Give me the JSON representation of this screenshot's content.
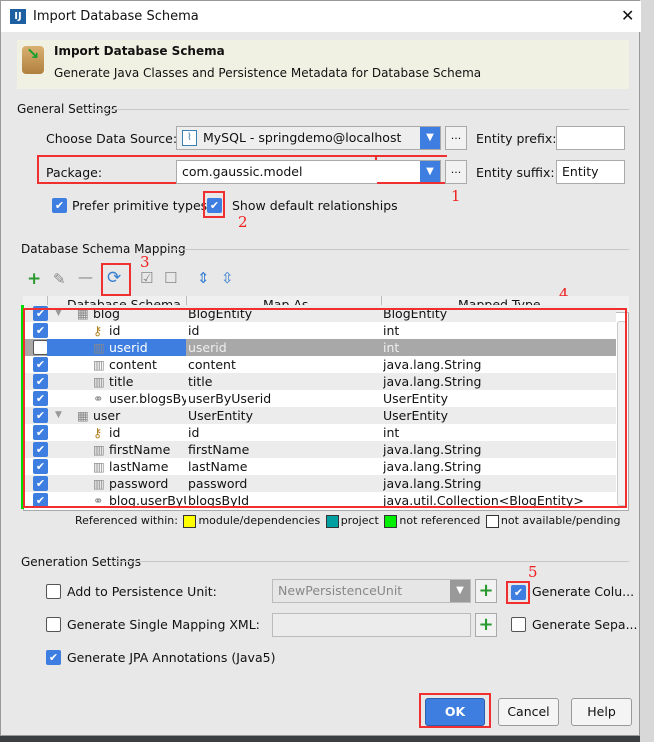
{
  "window": {
    "title": "Import Database Schema",
    "close": "✕"
  },
  "banner": {
    "title": "Import Database Schema",
    "subtitle": "Generate Java Classes and Persistence Metadata for Database Schema"
  },
  "general": {
    "section": "General Settings",
    "datasource_label": "Choose Data Source:",
    "datasource_value": "MySQL - springdemo@localhost",
    "package_label": "Package:",
    "package_value": "com.gaussic.model",
    "entity_prefix_label": "Entity prefix:",
    "entity_prefix_value": "",
    "entity_suffix_label": "Entity suffix:",
    "entity_suffix_value": "Entity",
    "prefer_primitive": {
      "label": "Prefer primitive types",
      "checked": true
    },
    "show_default_rel": {
      "label": "Show default relationships",
      "checked": true
    },
    "dots": "..."
  },
  "mapping": {
    "section": "Database Schema Mapping",
    "columns": [
      "Database Schema",
      "Map As",
      "Mapped Type"
    ],
    "rows": [
      {
        "checked": true,
        "level": 0,
        "icon": "table-icon",
        "schema": "blog",
        "map": "BlogEntity",
        "type": "BlogEntity"
      },
      {
        "checked": true,
        "level": 1,
        "icon": "key-icon",
        "schema": "id",
        "map": "id",
        "type": "int"
      },
      {
        "checked": false,
        "level": 1,
        "icon": "column-icon",
        "schema": "userid",
        "map": "userid",
        "type": "int",
        "selected": true
      },
      {
        "checked": true,
        "level": 1,
        "icon": "column-icon",
        "schema": "content",
        "map": "content",
        "type": "java.lang.String"
      },
      {
        "checked": true,
        "level": 1,
        "icon": "column-icon",
        "schema": "title",
        "map": "title",
        "type": "java.lang.String"
      },
      {
        "checked": true,
        "level": 1,
        "icon": "relation-icon",
        "schema": "user.blogsByUserid",
        "map": "userByUserid",
        "type": "UserEntity"
      },
      {
        "checked": true,
        "level": 0,
        "icon": "table-icon",
        "schema": "user",
        "map": "UserEntity",
        "type": "UserEntity"
      },
      {
        "checked": true,
        "level": 1,
        "icon": "key-icon",
        "schema": "id",
        "map": "id",
        "type": "int"
      },
      {
        "checked": true,
        "level": 1,
        "icon": "column-icon",
        "schema": "firstName",
        "map": "firstName",
        "type": "java.lang.String"
      },
      {
        "checked": true,
        "level": 1,
        "icon": "column-icon",
        "schema": "lastName",
        "map": "lastName",
        "type": "java.lang.String"
      },
      {
        "checked": true,
        "level": 1,
        "icon": "column-icon",
        "schema": "password",
        "map": "password",
        "type": "java.lang.String"
      },
      {
        "checked": true,
        "level": 1,
        "icon": "relation-icon",
        "schema": "blog.userByUserid",
        "map": "blogsById",
        "type": "java.util.Collection<BlogEntity>"
      }
    ],
    "legend": {
      "label": "Referenced within:",
      "items": [
        {
          "label": "module/dependencies",
          "color": "#ffff00"
        },
        {
          "label": "project",
          "color": "#00a0a0"
        },
        {
          "label": "not referenced",
          "color": "#00ee00"
        },
        {
          "label": "not available/pending",
          "color": "#ffffff"
        }
      ]
    }
  },
  "generation": {
    "section": "Generation Settings",
    "add_persistence": {
      "label": "Add to Persistence Unit:",
      "checked": false,
      "value": "NewPersistenceUnit"
    },
    "single_xml": {
      "label": "Generate Single Mapping XML:",
      "checked": false,
      "value": ""
    },
    "jpa": {
      "label": "Generate JPA Annotations (Java5)",
      "checked": true
    },
    "gen_column": {
      "label": "Generate Colu...",
      "checked": true
    },
    "gen_separate": {
      "label": "Generate Sepa...",
      "checked": false
    }
  },
  "annotations": [
    "1",
    "2",
    "3",
    "4",
    "5"
  ],
  "buttons": {
    "ok": "OK",
    "cancel": "Cancel",
    "help": "Help"
  },
  "colors": {
    "accent": "#3d7ee0",
    "annotation": "#f03030",
    "not_referenced": "#00ee00"
  }
}
